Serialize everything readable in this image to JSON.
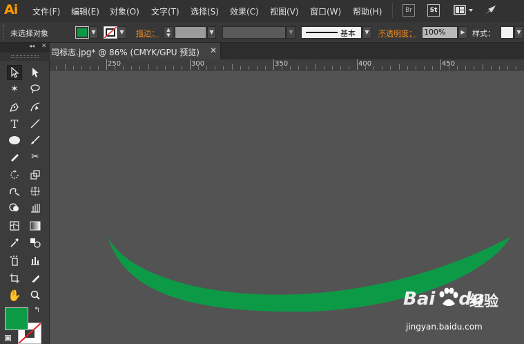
{
  "app": {
    "logo": "Ai",
    "accent": "#ff9a00"
  },
  "menu": [
    "文件(F)",
    "编辑(E)",
    "对象(O)",
    "文字(T)",
    "选择(S)",
    "效果(C)",
    "视图(V)",
    "窗口(W)",
    "帮助(H)"
  ],
  "toolbar_icons": {
    "br": "Br",
    "st": "St"
  },
  "control": {
    "selection_status": "未选择对象",
    "fill_color": "#0d9a47",
    "stroke_label": "描边：",
    "stroke_style_label": "基本",
    "opacity_label": "不透明度：",
    "opacity_value": "100%",
    "style_label": "样式："
  },
  "document": {
    "tab_title": "司标志.jpg* @ 86% (CMYK/GPU 预览)",
    "close_glyph": "✕"
  },
  "ruler": {
    "labels": [
      "250",
      "300",
      "350",
      "400",
      "450"
    ]
  },
  "artwork": {
    "arc_color": "#0d9a47"
  },
  "tools": {
    "fill_swatch": "#0d9a47",
    "panel_collapse": "◂◂",
    "panel_close": "✕"
  },
  "watermark": {
    "brand": "Bai",
    "brand2": "du",
    "cn": "经验",
    "url": "jingyan.baidu.com"
  }
}
